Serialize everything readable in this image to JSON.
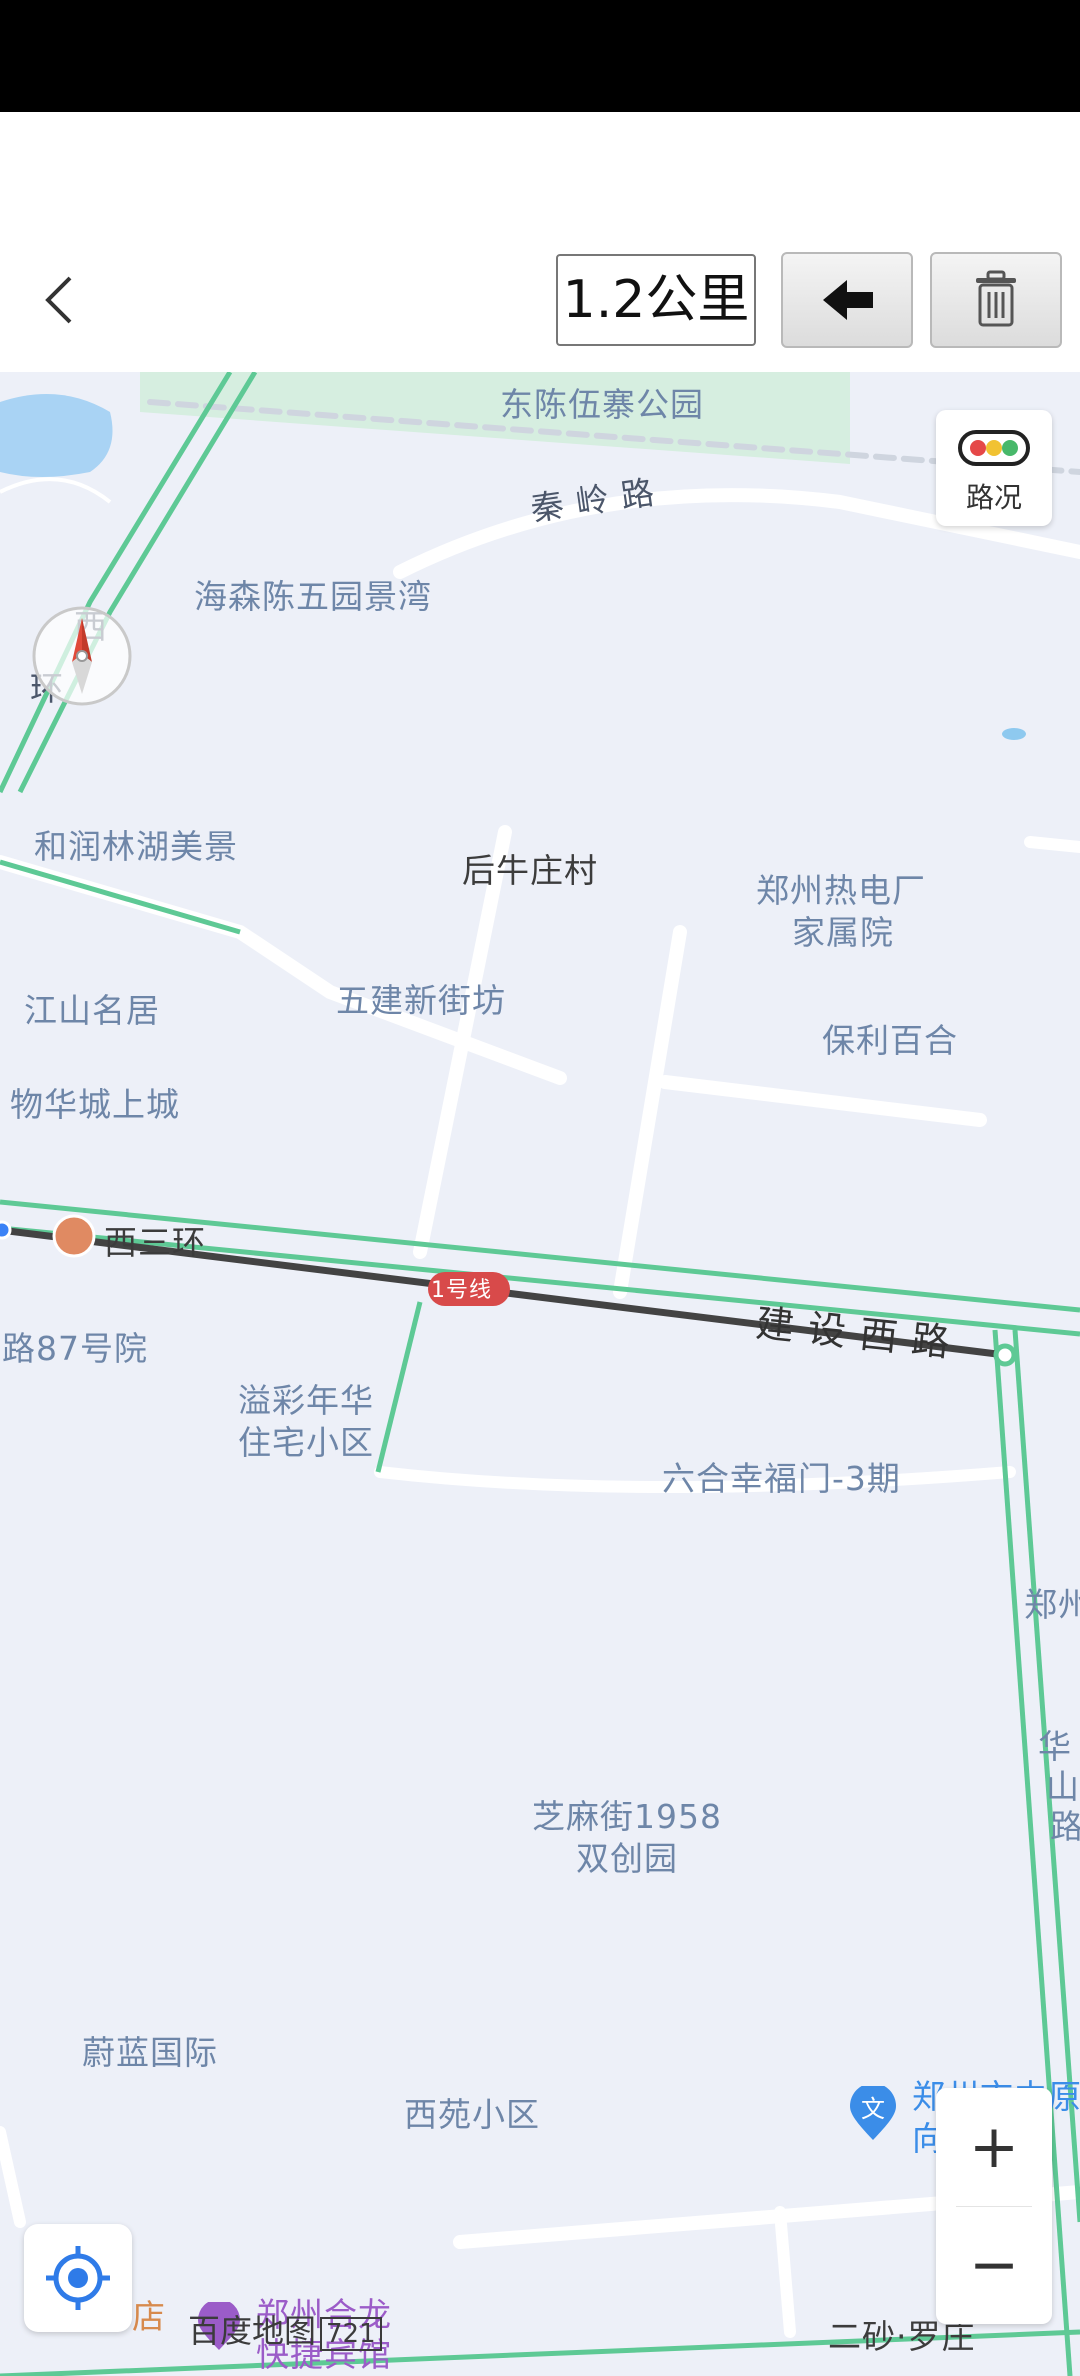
{
  "toolbar": {
    "distance": "1.2公里"
  },
  "map": {
    "traffic_label": "路况",
    "route_color": "#434343",
    "road_color": "#5ec995",
    "metro_line_badge": "1号线",
    "labels": {
      "dongchen_park": "东陈伍寨公园",
      "qinling_road": "秦 岭 路",
      "haisen": "海森陈五园景湾",
      "west3ring_a": "西",
      "west3ring_b": "环",
      "herun": "和润林湖美景",
      "houniu": "后牛庄村",
      "thermal_1": "郑州热电厂",
      "thermal_2": "家属院",
      "wujian": "五建新街坊",
      "jiangshan": "江山名居",
      "baoli": "保利百合",
      "huacheng": "物华城上城",
      "metro_station": "西三环",
      "jianshe_road": "建 设 西 路",
      "road87": "路87号院",
      "yicai_1": "溢彩年华",
      "yicai_2": "住宅小区",
      "liuhe": "六合幸福门-3期",
      "zheng_edge": "郑州",
      "huashan_1": "华",
      "huashan_2": "山",
      "huashan_3": "路",
      "zhima_1": "芝麻街1958",
      "zhima_2": "双创园",
      "weilan": "蔚蓝国际",
      "xiyuan": "西苑小区",
      "school_1": "郑州市中原",
      "school_2": "向",
      "hotel_edge": "店",
      "hotel_1": "郑州合龙",
      "hotel_2": "快捷宾馆",
      "ersha": "二砂·罗庄"
    },
    "logo_text": "百度地图",
    "logo_num": "721"
  }
}
